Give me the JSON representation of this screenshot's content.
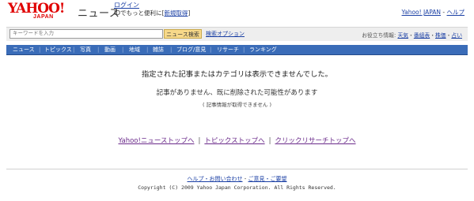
{
  "header": {
    "logo_text": "YAHOO!",
    "logo_sub": "JAPAN",
    "service_title": "ニュース",
    "login_label": "ログイン",
    "login_sub": "IDでもっと便利に",
    "signup_label": "新規取得",
    "yahoo_japan_link": "Yahoo! JAPAN",
    "help_link": "ヘルプ",
    "top_sep": " - "
  },
  "search": {
    "placeholder": "キーワードを入力",
    "button_label": "ニュース検索",
    "options_label": "検索オプション",
    "quick_info_label": "お役立ち情報:",
    "quick_links": [
      "天気",
      "番組表",
      "株価",
      "占い"
    ]
  },
  "nav": {
    "items": [
      "ニュース",
      "トピックス",
      "写真",
      "動画",
      "地域",
      "雑誌",
      "ブログ/意見",
      "リサーチ",
      "ランキング"
    ]
  },
  "main": {
    "heading": "指定された記事またはカテゴリは表示できませんでした。",
    "sub_message": "記事がありません、既に削除された可能性があります",
    "note": "( 記事情報が取得できません )",
    "links": [
      "Yahoo!ニューストップへ",
      "トピックストップへ",
      "クリックリサーチトップへ"
    ],
    "link_sep": "|"
  },
  "footer": {
    "help_contact": "ヘルプ・お問い合わせ",
    "opinion": "ご意見・ご要望",
    "footer_sep": " - ",
    "copyright": "Copyright (C) 2009 Yahoo Japan Corporation. All Rights Reserved."
  }
}
